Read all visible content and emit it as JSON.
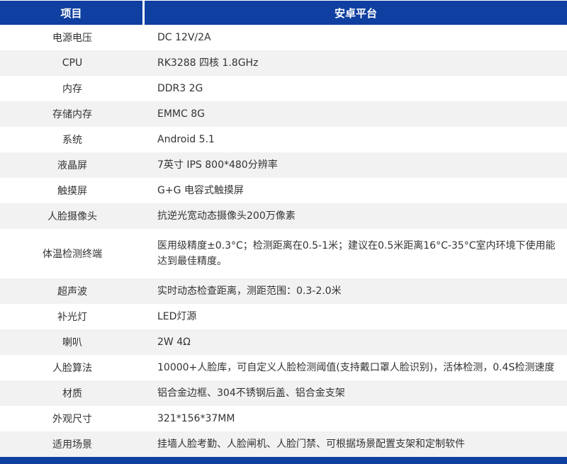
{
  "header": {
    "key": "项目",
    "value": "安卓平台"
  },
  "rows": [
    {
      "key": "电源电压",
      "value": "DC 12V/2A"
    },
    {
      "key": "CPU",
      "value": "RK3288  四核  1.8GHz"
    },
    {
      "key": "内存",
      "value": "DDR3 2G"
    },
    {
      "key": "存储内存",
      "value": "EMMC 8G"
    },
    {
      "key": "系统",
      "value": "Android 5.1"
    },
    {
      "key": "液晶屏",
      "value": "7英寸 IPS 800*480分辨率"
    },
    {
      "key": "触摸屏",
      "value": "G+G 电容式触摸屏"
    },
    {
      "key": "人脸摄像头",
      "value": "抗逆光宽动态摄像头200万像素"
    },
    {
      "key": "体温检测终端",
      "value": "医用级精度±0.3°C；检测距离在0.5-1米；建议在0.5米距离16°C-35°C室内环境下使用能达到最佳精度。"
    },
    {
      "key": "超声波",
      "value": "实时动态检查距离，测距范围：0.3-2.0米"
    },
    {
      "key": "补光灯",
      "value": "LED灯源"
    },
    {
      "key": "喇叭",
      "value": "2W 4Ω"
    },
    {
      "key": "人脸算法",
      "value": "10000+人脸库，可自定义人脸检测阈值(支持戴口罩人脸识别)，活体检测，0.4S检测速度"
    },
    {
      "key": "材质",
      "value": "铝合金边框、304不锈钢后盖、铝合金支架"
    },
    {
      "key": "外观尺寸",
      "value": "321*156*37MM"
    },
    {
      "key": "适用场景",
      "value": "挂墙人脸考勤、人脸闸机、人脸门禁、可根据场景配置支架和定制软件"
    }
  ]
}
